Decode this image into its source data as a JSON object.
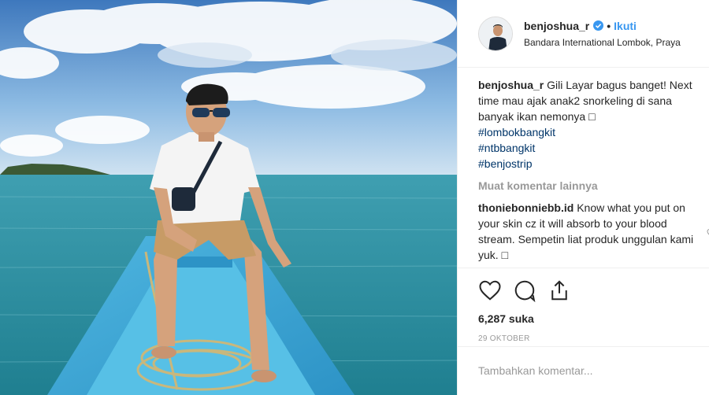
{
  "post": {
    "username": "benjoshua_r",
    "follow_label": "Ikuti",
    "dot": "•",
    "location": "Bandara International Lombok, Praya",
    "caption": {
      "username": "benjoshua_r",
      "text": "Gili Layar bagus banget! Next time mau ajak anak2 snorkeling di sana banyak ikan nemonya □",
      "hashtags": [
        "#lombokbangkit",
        "#ntbbangkit",
        "#benjostrip"
      ]
    },
    "load_more_label": "Muat komentar lainnya",
    "comment": {
      "username": "thoniebonniebb.id",
      "text": "Know what you put on your skin cz it will absorb to your blood stream. Sempetin liat produk unggulan kami yuk. □"
    },
    "likes": "6,287 suka",
    "date": "29 OKTOBER",
    "add_comment_placeholder": "Tambahkan komentar..."
  },
  "icons": {
    "like": "heart-icon",
    "comment": "comment-bubble-icon",
    "share": "share-icon",
    "verified": "verified-badge-icon",
    "comment_like": "small-heart-icon"
  },
  "colors": {
    "link": "#3897f0",
    "hashtag": "#003569",
    "muted": "#999999",
    "text": "#262626"
  }
}
